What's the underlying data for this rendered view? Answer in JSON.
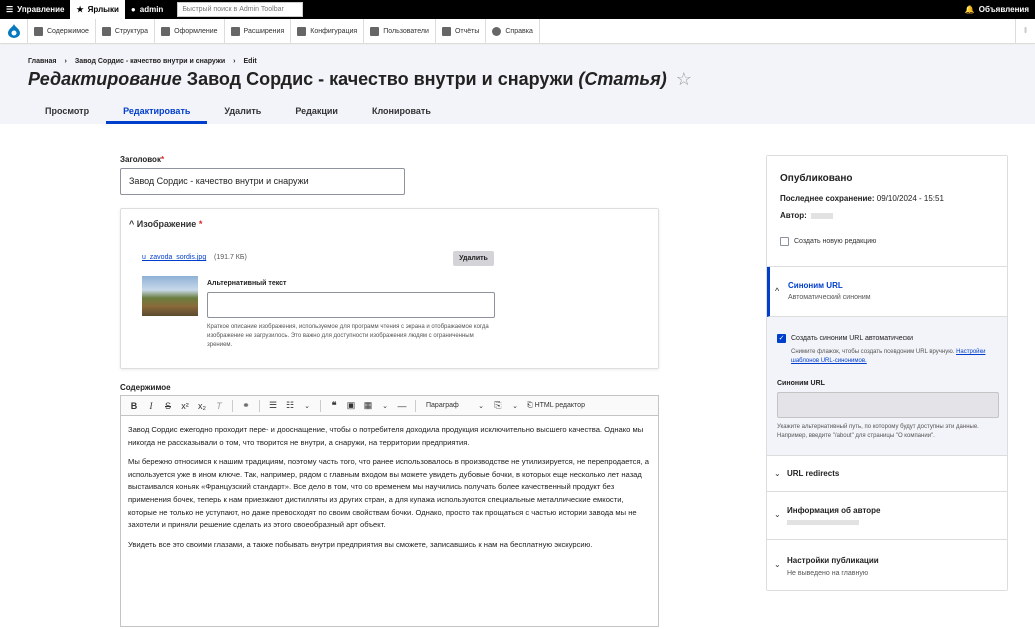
{
  "topbar": {
    "manage": "Управление",
    "shortcuts": "Ярлыки",
    "user": "admin",
    "search_placeholder": "Быстрый поиск в Admin Toolbar",
    "announcements": "Объявления"
  },
  "menu": [
    "Содержимое",
    "Структура",
    "Оформление",
    "Расширения",
    "Конфигурация",
    "Пользователи",
    "Отчёты",
    "Справка"
  ],
  "breadcrumb": [
    "Главная",
    "Завод Сордис - качество внутри и снаружи",
    "Edit"
  ],
  "page_title": {
    "prefix": "Редактирование",
    "name": "Завод Сордис - качество внутри и снаружи",
    "type": "(Статья)"
  },
  "tabs": [
    "Просмотр",
    "Редактировать",
    "Удалить",
    "Редакции",
    "Клонировать"
  ],
  "form": {
    "title_label": "Заголовок",
    "title_value": "Завод Сордис - качество внутри и снаружи",
    "image_label": "Изображение",
    "file_name": "u_zavoda_sordis.jpg",
    "file_size": "(191.7 КБ)",
    "delete_button": "Удалить",
    "alt_label": "Альтернативный текст",
    "alt_desc": "Краткое описание изображения, используемое для программ чтения с экрана и отображаемое когда изображение не загрузилось. Это важно для доступности изображения людям с ограниченным зрением.",
    "content_label": "Содержимое",
    "format_select": "Параграф",
    "html_editor": "HTML редактор",
    "paragraphs": [
      "Завод Сордис ежегодно проходит пере- и дооснащение, чтобы о потребителя доходила продукция исключительно высшего качества. Однако мы никогда не рассказывали о том, что творится не внутри, а снаружи, на территории предприятия.",
      "Мы бережно относимся к нашим традициям, поэтому часть того, что ранее использовалось в производстве не утилизируется, не перепродается, а используется уже в ином ключе. Так, например, рядом с главным входом вы можете увидеть дубовые бочки, в которых еще несколько лет назад выстаивался коньяк «Французский стандарт». Все дело в том, что со временем мы научились получать более качественный продукт без применения бочек, теперь к нам приезжают дистилляты из других стран, а для купажа используются специальные металлические емкости, которые не только не уступают, но даже превосходят по своим свойствам бочки. Однако, просто так прощаться с частью истории завода мы не захотели и приняли решение сделать из этого своеобразный арт объект.",
      "Увидеть все это своими глазами, а также побывать внутри предприятия вы сможете, записавшись к нам на бесплатную экскурсию."
    ]
  },
  "sidebar": {
    "status": "Опубликовано",
    "last_saved_label": "Последнее сохранение:",
    "last_saved_value": "09/10/2024 - 15:51",
    "author_label": "Автор:",
    "new_revision": "Создать новую редакцию",
    "alias_title": "Синоним URL",
    "alias_sub": "Автоматический синоним",
    "alias_auto": "Создать синоним URL автоматически",
    "alias_auto_desc": "Снимите флажок, чтобы создать псевдоним URL вручную.",
    "alias_auto_link": "Настройки шаблонов URL-синонимов.",
    "alias_field_label": "Синоним URL",
    "alias_hint": "Укажите альтернативный путь, по которому будут доступны эти данные. Например, введите \"/about\" для страницы \"О компании\".",
    "redirects": "URL redirects",
    "author_info": "Информация об авторе",
    "publish_settings": "Настройки публикации",
    "publish_settings_sub": "Не выведено на главную"
  }
}
